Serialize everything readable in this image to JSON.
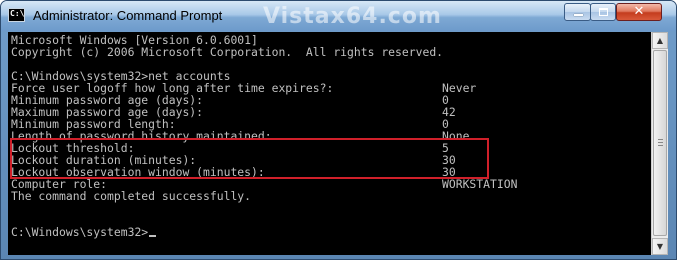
{
  "window": {
    "title": "Administrator: Command Prompt",
    "icon_name": "cmd-icon",
    "icon_text": "C:\\"
  },
  "watermark": "Vistax64.com",
  "controls": {
    "minimize_icon": "minimize-icon",
    "maximize_icon": "maximize-icon",
    "close_icon": "close-icon",
    "close_glyph": "✕"
  },
  "console": {
    "lines": [
      {
        "text": "Microsoft Windows [Version 6.0.6001]"
      },
      {
        "text": "Copyright (c) 2006 Microsoft Corporation.  All rights reserved."
      },
      {
        "text": ""
      },
      {
        "text": "C:\\Windows\\system32>net accounts"
      },
      {
        "text": "Force user logoff how long after time expires?:",
        "value": "Never"
      },
      {
        "text": "Minimum password age (days):",
        "value": "0"
      },
      {
        "text": "Maximum password age (days):",
        "value": "42"
      },
      {
        "text": "Minimum password length:",
        "value": "0"
      },
      {
        "text": "Length of password history maintained:",
        "value": "None"
      },
      {
        "text": "Lockout threshold:",
        "value": "5"
      },
      {
        "text": "Lockout duration (minutes):",
        "value": "30"
      },
      {
        "text": "Lockout observation window (minutes):",
        "value": "30"
      },
      {
        "text": "Computer role:",
        "value": "WORKSTATION"
      },
      {
        "text": "The command completed successfully."
      },
      {
        "text": ""
      },
      {
        "text": ""
      },
      {
        "text": "C:\\Windows\\system32>"
      }
    ],
    "highlight_color": "#d0202a"
  },
  "scrollbar": {
    "up_glyph": "▲",
    "down_glyph": "▼"
  }
}
